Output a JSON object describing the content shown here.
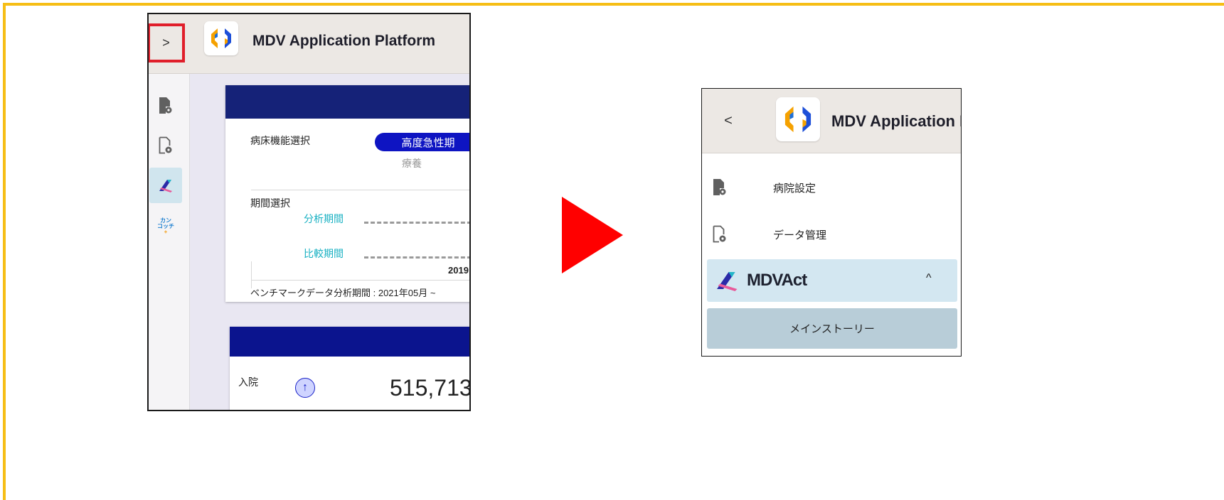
{
  "colors": {
    "frame": "#f6be16",
    "highlight": "#e01e2a",
    "arrow": "#ff0000",
    "card_band": "#152278",
    "pill": "#0e14c2",
    "teal_text": "#17b0c2",
    "active_rail": "#d0e5ee",
    "section_bg": "#d3e7f1",
    "sub_bg": "#b8cdd8"
  },
  "before": {
    "header": {
      "toggle_icon": "chevron-right-icon",
      "toggle_glyph": ">",
      "app_title": "MDV Application Platform"
    },
    "rail": {
      "icons": [
        "hospital-settings-icon",
        "data-management-icon",
        "mdvact-icon",
        "kanko-plus-icon"
      ],
      "kanko_line1": "カン",
      "kanko_line2": "コッチ",
      "kanko_plus": "+"
    },
    "card1": {
      "bed_function_label": "病床機能選択",
      "bed_option_selected": "高度急性期",
      "bed_option_other": "療養",
      "period_label": "期間選択",
      "analysis_period": "分析期間",
      "comparison_period": "比較期間",
      "year_partial": "2019",
      "benchmark_text": "ベンチマークデータ分析期間 : 2021年05月 ~"
    },
    "card2": {
      "admission_label": "入院",
      "trend_icon": "arrow-up-icon",
      "admission_value": "515,713"
    }
  },
  "after": {
    "header": {
      "back_icon": "chevron-left-icon",
      "back_glyph": "<",
      "app_title": "MDV Application Platform"
    },
    "menu": {
      "hospital_settings": "病院設定",
      "data_management": "データ管理",
      "section_title": "MDVAct",
      "section_chevron": "^",
      "main_story": "メインストーリー"
    }
  }
}
